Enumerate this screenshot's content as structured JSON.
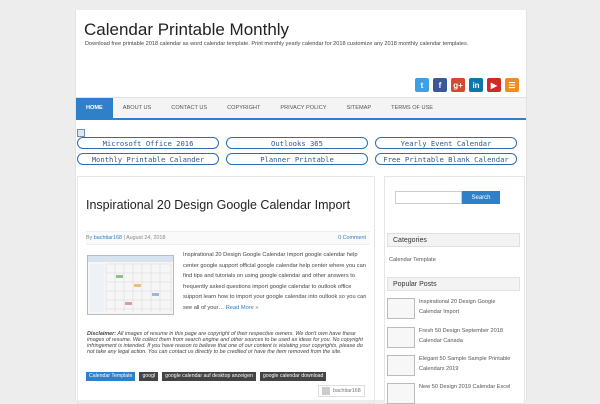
{
  "site": {
    "title": "Calendar Printable Monthly",
    "description": "Download free printable 2018 calendar as word calendar template. Print monthly yearly calendar for 2018 customize any 2018 monthly calendar templates."
  },
  "social": [
    {
      "name": "twitter-icon",
      "glyph": "t",
      "color": "#3ba0e6"
    },
    {
      "name": "facebook-icon",
      "glyph": "f",
      "color": "#3b5998"
    },
    {
      "name": "google-plus-icon",
      "glyph": "g+",
      "color": "#d6492f"
    },
    {
      "name": "linkedin-icon",
      "glyph": "in",
      "color": "#0e76a8"
    },
    {
      "name": "youtube-icon",
      "glyph": "▶",
      "color": "#d02a26"
    },
    {
      "name": "rss-icon",
      "glyph": "☰",
      "color": "#f08a24"
    }
  ],
  "nav": [
    "HOME",
    "ABOUT US",
    "CONTACT US",
    "COPYRIGHT",
    "PRIVACY POLICY",
    "SITEMAP",
    "TERMS OF USE"
  ],
  "pills": [
    "Microsoft Office 2016",
    "Outlooks 365",
    "Yearly Event Calendar",
    "Monthly Printable Calander",
    "Planner Printable",
    "Free Printable Blank Calendar"
  ],
  "post": {
    "title": "Inspirational 20 Design Google Calendar Import",
    "meta_by": "By",
    "author": "bachtiar168",
    "date": "| August 24, 2018",
    "comments": "0 Comment",
    "excerpt": "Inspirational 20 Design Google Calendar Import  google calendar help center google support official google calendar help center where you can find tips and tutorials on using google calendar and other answers to frequently asked questions import google calendar to outlook office support learn how to import your google calendar into outlook so you can see all of your…",
    "read_more": "Read More »",
    "disclaimer_label": "Disclaimer:",
    "disclaimer": "All images of resume in this page are copyright of their respective owners. We don't own have these images of resume. We collect them from search engine and other sources to be used as ideas for you. No copyright infringement is intended. If you have reason to believe that one of our content is violating your copyrights, please do not take any legal action. You can contact us directly to be credited or have the item removed from the site.",
    "tags": [
      "Calendar Template",
      "googl",
      "google calendar auf desktop anzeigen",
      "google calendar download"
    ],
    "byline": "bachtiar168"
  },
  "sidebar": {
    "search_placeholder": "",
    "search_button": "Search",
    "categories_title": "Categories",
    "categories": [
      "Calendar Template"
    ],
    "popular_title": "Popular Posts",
    "popular": [
      "Inspirational 20 Design Google Calendar Import",
      "Fresh 50 Design September 2018 Calendar Canada",
      "Elegant 50 Sample Sample Printable Calendars 2019",
      "New 50 Design 2019 Calendar Excel"
    ]
  },
  "colors": {
    "accent": "#2f80c8",
    "pill_border": "#2f6db3"
  }
}
